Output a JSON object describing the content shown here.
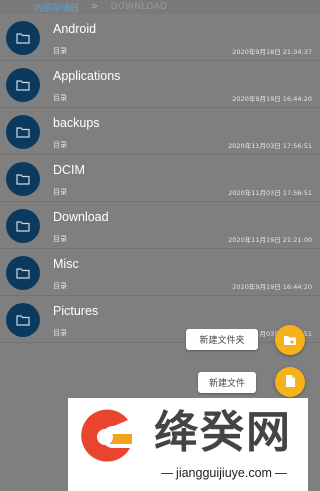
{
  "breadcrumb": {
    "root": "内部存储器",
    "separator": ">",
    "current": "DOWNLOAD"
  },
  "files": [
    {
      "name": "Android",
      "type": "目录",
      "date": "2020年9月18日 21:34:37"
    },
    {
      "name": "Applications",
      "type": "目录",
      "date": "2020年9月19日 16:44:20"
    },
    {
      "name": "backups",
      "type": "目录",
      "date": "2020年11月03日 17:56:51"
    },
    {
      "name": "DCIM",
      "type": "目录",
      "date": "2020年11月03日 17:56:51"
    },
    {
      "name": "Download",
      "type": "目录",
      "date": "2020年11月19日 21:21:00"
    },
    {
      "name": "Misc",
      "type": "目录",
      "date": "2020年9月19日 16:44:20"
    },
    {
      "name": "Pictures",
      "type": "目录",
      "date": "2020年11月03日 17:56:51"
    }
  ],
  "fab_menu": {
    "new_folder_label": "新建文件夹",
    "new_file_label": "新建文件"
  },
  "watermark": {
    "title": "绛癸网",
    "url": "jiangguijiuye.com"
  },
  "colors": {
    "overlay": "#7f7f7f",
    "folder_icon_bg": "#0b3a5e",
    "fab": "#f5b21a",
    "crumb_link": "#5da1c9"
  },
  "icons": {
    "folder": "folder-icon",
    "new_folder": "new-folder-icon",
    "new_file": "new-file-icon",
    "logo": "brand-logo"
  }
}
